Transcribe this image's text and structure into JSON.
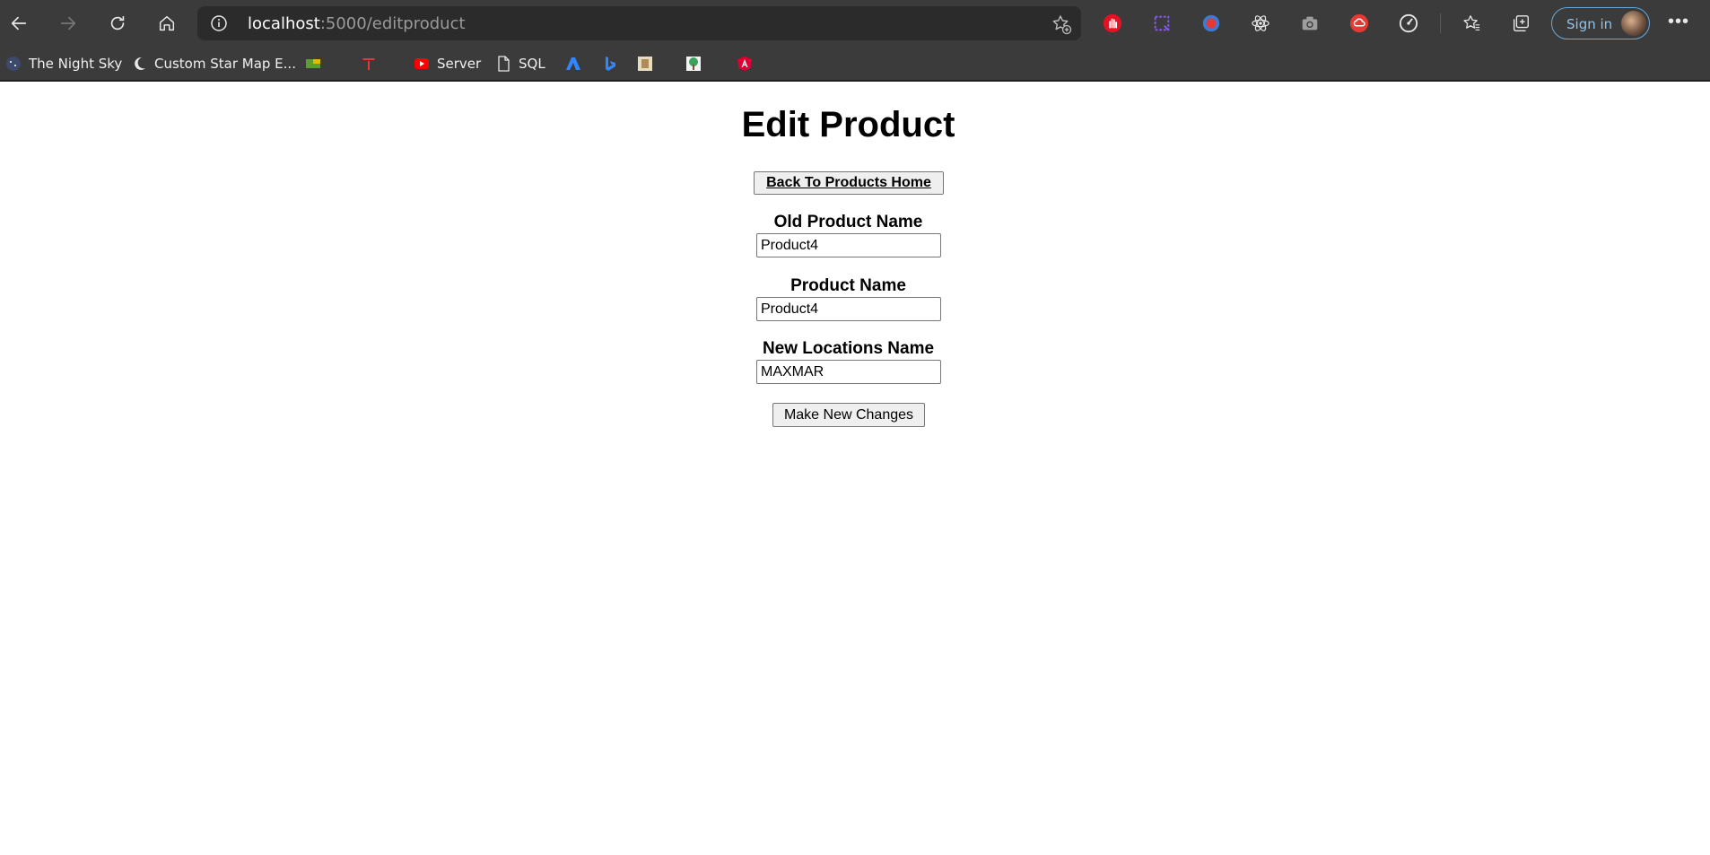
{
  "browser": {
    "url_host": "localhost",
    "url_path": ":5000/editproduct",
    "signin_label": "Sign in",
    "toolbar_icons": [
      "back-icon",
      "forward-icon",
      "refresh-icon",
      "home-icon",
      "site-info-icon",
      "add-favorite-icon"
    ],
    "extension_icons": [
      "hand-stop-icon",
      "screenshot-capture-icon",
      "red-dot-icon",
      "react-devtools-icon",
      "camera-icon",
      "cloud-icon",
      "speedometer-icon",
      "favorites-icon",
      "collections-icon",
      "more-menu-icon"
    ]
  },
  "bookmarks": [
    {
      "label": "The Night Sky",
      "icon": "night-sky-icon"
    },
    {
      "label": "Custom Star Map E...",
      "icon": "moon-icon"
    },
    {
      "label": "",
      "icon": "flag-icon"
    },
    {
      "label": "",
      "icon": "tesla-icon"
    },
    {
      "label": "Server",
      "icon": "youtube-icon"
    },
    {
      "label": "SQL",
      "icon": "document-icon"
    },
    {
      "label": "",
      "icon": "azure-icon"
    },
    {
      "label": "",
      "icon": "bing-icon"
    },
    {
      "label": "",
      "icon": "image-bookmark-icon"
    },
    {
      "label": "",
      "icon": "tree-icon"
    },
    {
      "label": "",
      "icon": "angular-icon"
    }
  ],
  "page": {
    "title": "Edit Product",
    "back_button": "Back To Products Home",
    "fields": [
      {
        "label": "Old Product Name",
        "value": "Product4"
      },
      {
        "label": "Product Name",
        "value": "Product4"
      },
      {
        "label": "New Locations Name",
        "value": "MAXMAR"
      }
    ],
    "submit_button": "Make New Changes"
  },
  "colors": {
    "chrome_bg": "#3b3b3b",
    "addressbar_bg": "#2b2b2b",
    "signin_border": "#6aa8d8",
    "page_bg": "#ffffff"
  }
}
